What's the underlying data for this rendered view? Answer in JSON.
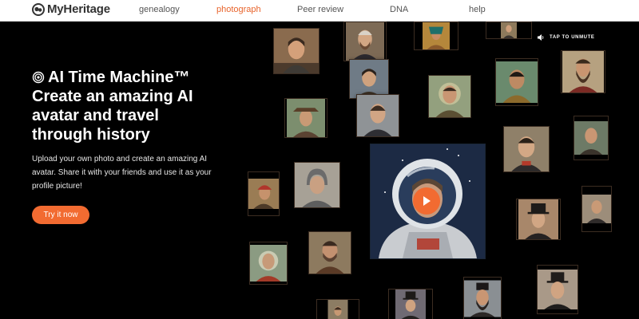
{
  "brand": {
    "name": "MyHeritage",
    "accent": "#f26b31"
  },
  "nav": {
    "items": [
      {
        "label": "genealogy",
        "active": false
      },
      {
        "label": "photograph",
        "active": true
      },
      {
        "label": "Peer review",
        "active": false
      },
      {
        "label": "DNA",
        "active": false
      },
      {
        "label": "help",
        "active": false
      }
    ]
  },
  "hero": {
    "headline_lines": [
      "AI Time Machine™",
      "Create an amazing AI",
      "avatar and travel",
      "through history"
    ],
    "subtitle": "Upload your own photo and create an amazing AI avatar. Share it with your friends and use it as your profile picture!",
    "cta_label": "Try it now",
    "unmute_label": "TAP TO UNMUTE",
    "icons": [
      "spiral-icon",
      "speaker-icon",
      "play-icon"
    ]
  },
  "colors": {
    "background": "#000000",
    "nav_bg": "#ffffff",
    "active_nav": "#e8642c",
    "cta": "#f26b31"
  }
}
